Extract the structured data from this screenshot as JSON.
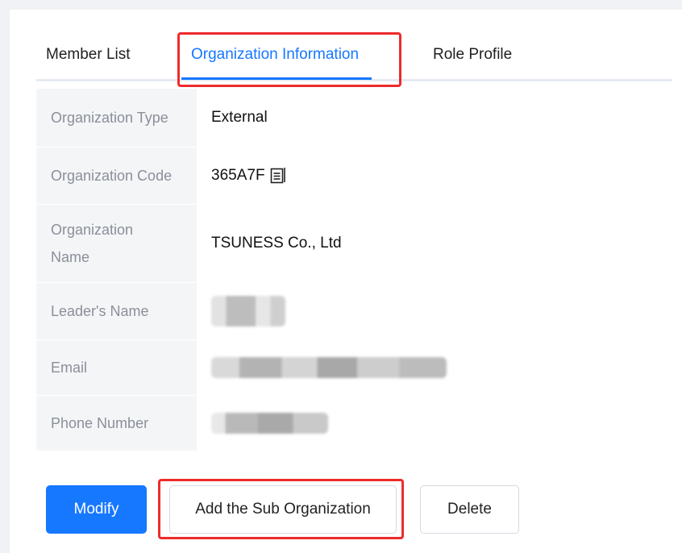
{
  "tabs": [
    {
      "label": "Member List",
      "active": false
    },
    {
      "label": "Organization Information",
      "active": true
    },
    {
      "label": "Role Profile",
      "active": false
    }
  ],
  "info": {
    "organization_type": {
      "label": "Organization Type",
      "value": "External"
    },
    "organization_code": {
      "label": "Organization Code",
      "value": "365A7F",
      "icon": "copy-icon"
    },
    "organization_name": {
      "label_line1": "Organization",
      "label_line2": "Name",
      "value": "TSUNESS Co., Ltd"
    },
    "leader_name": {
      "label": "Leader's Name"
    },
    "email": {
      "label": "Email"
    },
    "phone": {
      "label": "Phone Number"
    }
  },
  "buttons": {
    "modify": "Modify",
    "add_sub": "Add the Sub Organization",
    "delete": "Delete"
  },
  "colors": {
    "accent": "#1677ff",
    "highlight": "#ee2b2b",
    "label_bg": "#f4f5f7"
  }
}
